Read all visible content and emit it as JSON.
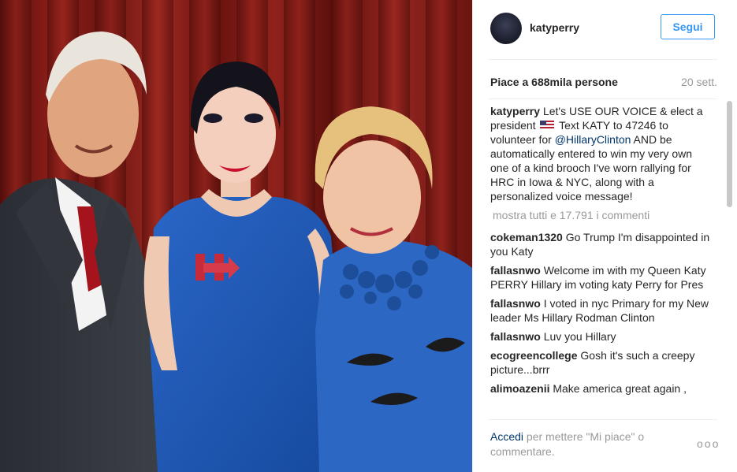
{
  "account": {
    "username": "katyperry",
    "follow_label": "Segui"
  },
  "post": {
    "likes": "Piace a 688mila persone",
    "age": "20 sett.",
    "caption_user": "katyperry",
    "caption_part1": "Let's USE OUR VOICE & elect a president ",
    "caption_flag": "flag-us-icon",
    "caption_part2": " Text KATY to 47246 to volunteer for ",
    "caption_mention": "@HillaryClinton",
    "caption_part3": " AND be automatically entered to win my very own one of a kind brooch I've worn rallying for HRC in Iowa & NYC, along with a personalized voice message!",
    "show_all": "mostra tutti e 17.791 i commenti"
  },
  "comments": [
    {
      "user": "cokeman1320",
      "text": "Go Trump I'm disappointed in you Katy"
    },
    {
      "user": "fallasnwo",
      "text": "Welcome im with my Queen Katy PERRY Hillary im voting katy Perry for Pres"
    },
    {
      "user": "fallasnwo",
      "text": "I voted in nyc Primary for my New leader Ms Hillary Rodman Clinton"
    },
    {
      "user": "fallasnwo",
      "text": "Luv you Hillary"
    },
    {
      "user": "ecogreencollege",
      "text": "Gosh it's such a creepy picture...brrr"
    },
    {
      "user": "alimoazenii",
      "text": "Make america great again ,"
    }
  ],
  "footer": {
    "login_link": "Accedi",
    "prompt": " per mettere \"Mi piace\" o commentare.",
    "more_icon": "more-options-icon",
    "more_glyph": "ooo"
  },
  "colors": {
    "accent": "#3897f0",
    "link": "#003569",
    "muted": "#999999"
  }
}
